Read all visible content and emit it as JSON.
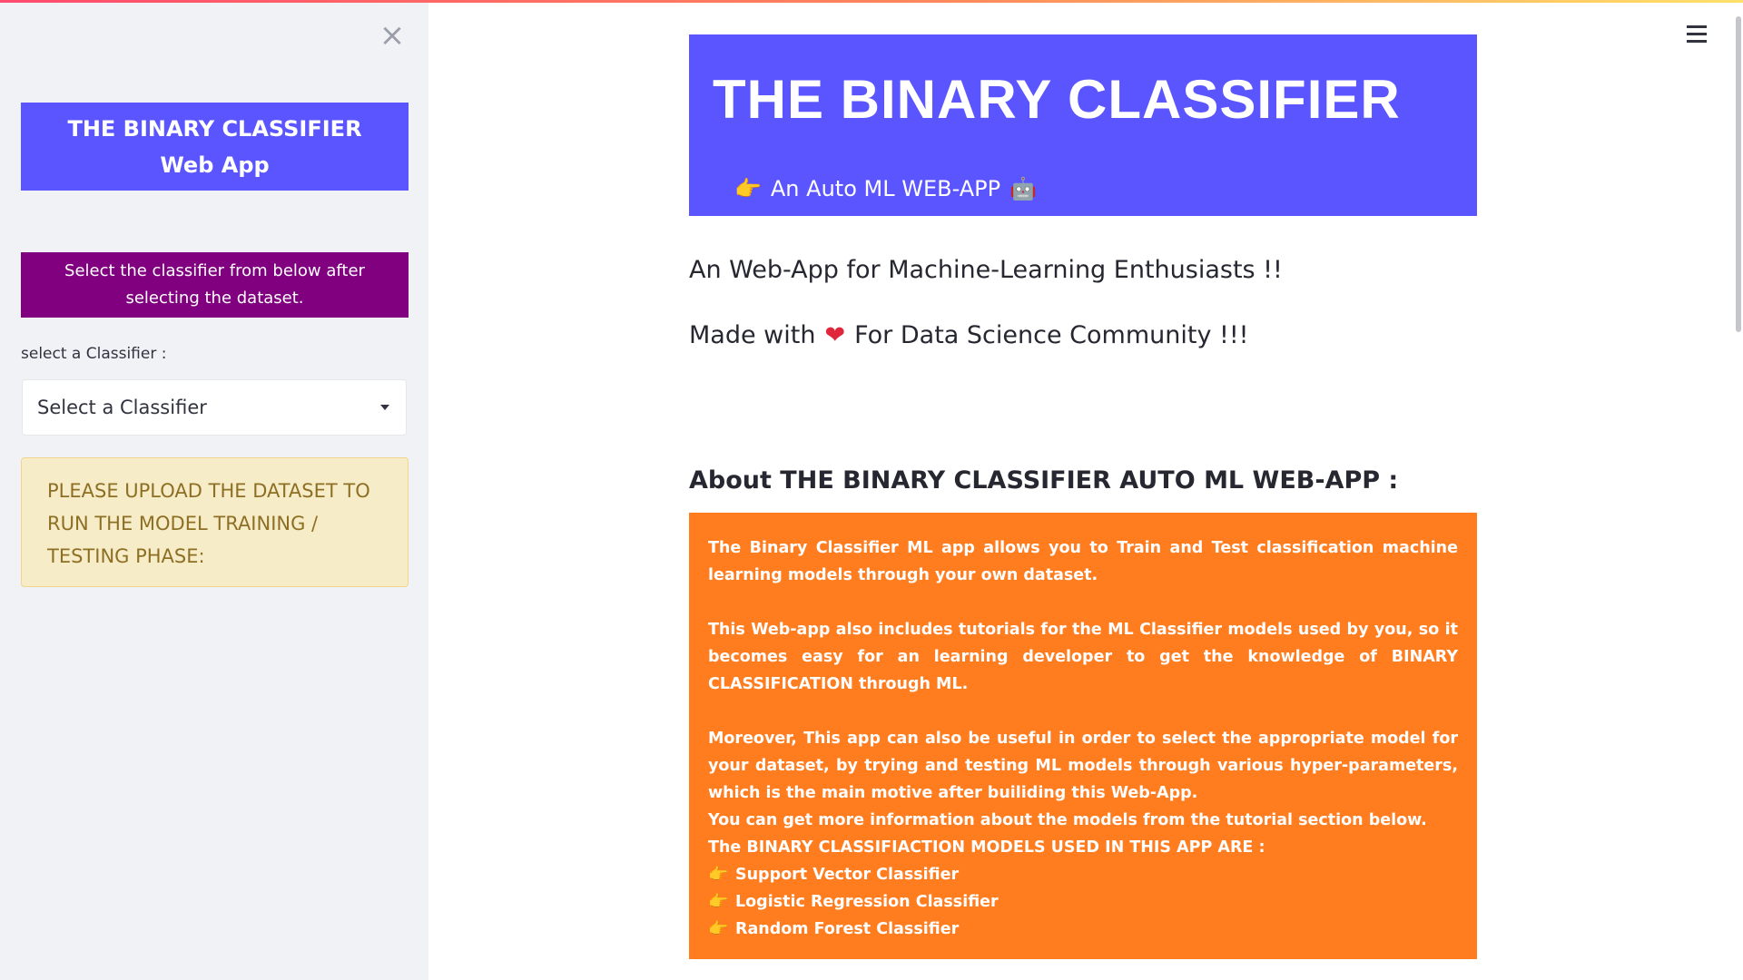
{
  "sidebar": {
    "close_glyph": "×",
    "title_line1": "THE BINARY CLASSIFIER",
    "title_line2": "Web App",
    "note": "Select the classifier from below after selecting the dataset.",
    "select_label": "select a Classifier :",
    "select_value": "Select a Classifier",
    "warning": "PLEASE UPLOAD THE DATASET TO RUN THE MODEL TRAINING / TESTING PHASE:"
  },
  "header": {
    "menu_icon": "hamburger-menu-icon"
  },
  "hero": {
    "title": "THE BINARY CLASSIFIER",
    "pointer_emoji": "👉",
    "subtitle": "An Auto ML WEB-APP",
    "robot_emoji": "🤖"
  },
  "intro": {
    "line1": "An Web-App for Machine-Learning Enthusiasts !!",
    "line2_prefix": "Made with",
    "heart_emoji": "❤",
    "line2_suffix": "For Data Science Community !!!"
  },
  "about": {
    "title": "About THE BINARY CLASSIFIER AUTO ML WEB-APP :",
    "p1": "The Binary Classifier ML app allows you to Train and Test classification machine learning models through your own dataset.",
    "p2": "This Web-app also includes tutorials for the ML Classifier models used by you, so it becomes easy for an learning developer to get the knowledge of BINARY CLASSIFICATION through ML.",
    "p3": "Moreover, This app can also be useful in order to select the appropriate model for your dataset, by trying and testing ML models through various hyper-parameters, which is the main motive after builiding this Web-App.",
    "p4": "You can get more information about the models from the tutorial section below.",
    "models_title": "The BINARY CLASSIFIACTION MODELS USED IN THIS APP ARE :",
    "pointer_emoji": "👉",
    "models": [
      "Support Vector Classifier",
      "Logistic Regression Classifier",
      "Random Forest Classifier"
    ]
  },
  "colors": {
    "accent": "#5a55ff",
    "note_bg": "#800080",
    "warning_bg": "#f7ecc8",
    "about_bg": "#ff7c1f"
  }
}
